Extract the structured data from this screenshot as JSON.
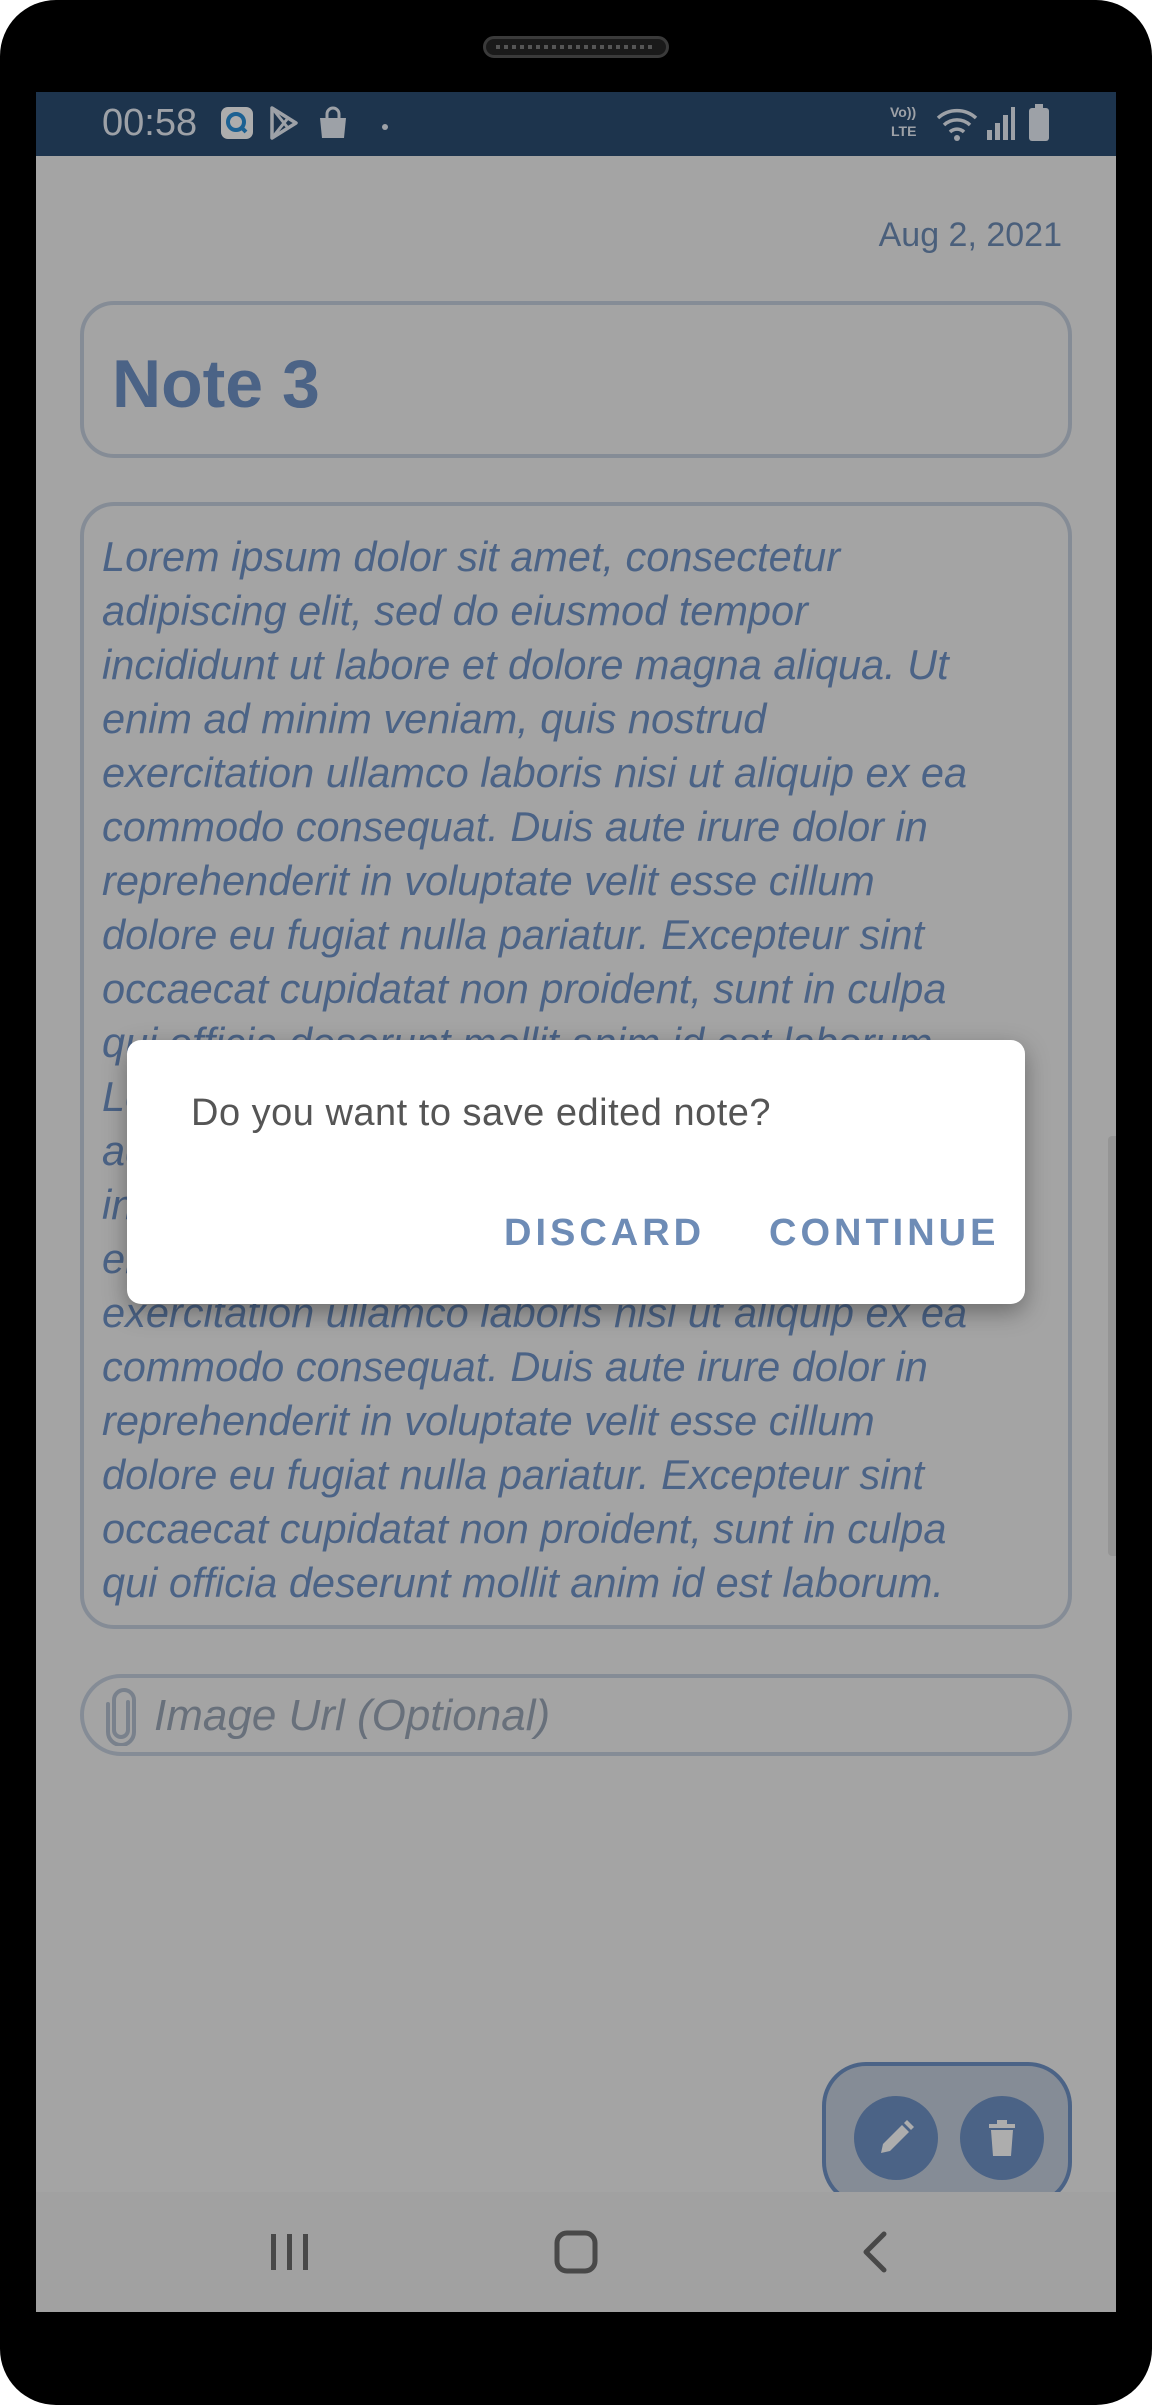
{
  "status_bar": {
    "time": "00:58",
    "network_label": "Vo)) LTE"
  },
  "note": {
    "date": "Aug 2, 2021",
    "title": "Note 3",
    "body": "Lorem ipsum dolor sit amet, consectetur\nadipiscing elit, sed do eiusmod tempor\nincididunt ut labore et dolore magna aliqua. Ut\nenim ad minim veniam, quis nostrud\nexercitation ullamco laboris nisi ut aliquip ex ea\ncommodo consequat. Duis aute irure dolor in\nreprehenderit in voluptate velit esse cillum\ndolore eu fugiat nulla pariatur. Excepteur sint\noccaecat cupidatat non proident, sunt in culpa\nqui officia deserunt mollit anim id est laborum.\nLorem ipsum dolor sit amet, consectetur\nadipiscing elit, sed do eiusmod tempor\nincididunt ut labore et dolore magna aliqua. Ut\nenim ad minim veniam, quis nostrud\nexercitation ullamco laboris nisi ut aliquip ex ea\ncommodo consequat. Duis aute irure dolor in\nreprehenderit in voluptate velit esse cillum\ndolore eu fugiat nulla pariatur. Excepteur sint\noccaecat cupidatat non proident, sunt in culpa\nqui officia deserunt mollit anim id est laborum.",
    "image_url_placeholder": "Image Url (Optional)",
    "image_url_value": ""
  },
  "dialog": {
    "message": "Do you want to save edited note?",
    "discard_label": "DISCARD",
    "continue_label": "CONTINUE"
  },
  "icons": {
    "attach": "paperclip-icon",
    "edit": "pencil-icon",
    "delete": "trash-icon",
    "nav_recents": "recents-icon",
    "nav_home": "home-icon",
    "nav_back": "back-icon"
  },
  "colors": {
    "status_bar": "#2c4d72",
    "accent": "#6f92c6",
    "outline": "#c5cfdd",
    "dialog_button": "#6e8cb6"
  }
}
